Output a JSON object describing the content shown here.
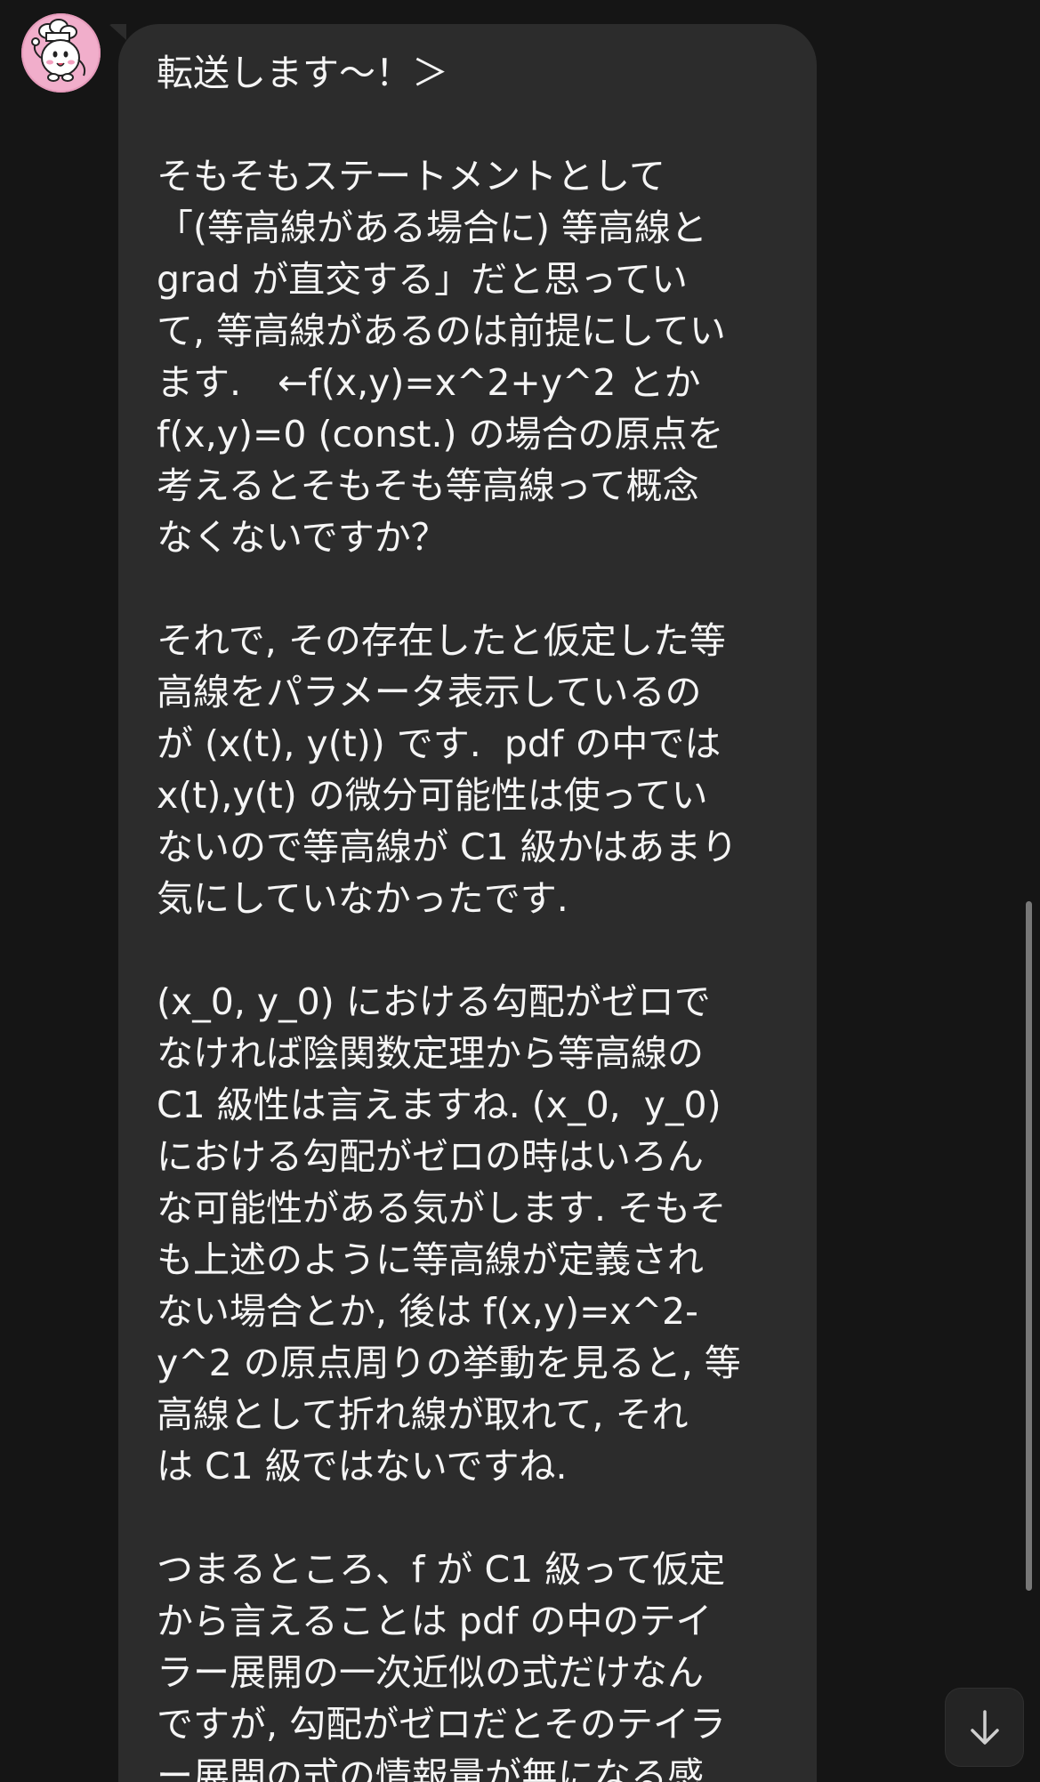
{
  "chat": {
    "message": {
      "lines": [
        "転送します〜！＞",
        "",
        "そもそもステートメントとして",
        "「(等高線がある場合に) 等高線と",
        "grad が直交する」だと思ってい",
        "て, 等高線があるのは前提にしてい",
        "ます.　←f(x,y)=x^2+y^2 とか",
        "f(x,y)=0 (const.) の場合の原点を",
        "考えるとそもそも等高線って概念",
        "なくないですか？",
        "",
        "それで, その存在したと仮定した等",
        "高線をパラメータ表示しているの",
        "が (x(t), y(t)) です.  pdf の中では",
        "x(t),y(t) の微分可能性は使ってい",
        "ないので等高線が C1 級かはあまり",
        "気にしていなかったです.",
        "",
        "(x_0, y_0) における勾配がゼロで",
        "なければ陰関数定理から等高線の",
        "C1 級性は言えますね. (x_0,  y_0)",
        "における勾配がゼロの時はいろん",
        "な可能性がある気がします. そもそ",
        "も上述のように等高線が定義され",
        "ない場合とか, 後は f(x,y)=x^2-",
        "y^2 の原点周りの挙動を見ると, 等",
        "高線として折れ線が取れて, それ",
        "は C1 級ではないですね.",
        "",
        "つまるところ、f が C1 級って仮定",
        "から言えることは pdf の中のテイ",
        "ラー展開の一次近似の式だけなん",
        "ですが, 勾配がゼロだとそのテイラ",
        "ー展開の式の情報量が無になる感"
      ],
      "bubble_color": "#2c2c2c",
      "text_color": "#f5f5f5"
    },
    "avatar": {
      "icon": "chef-character-avatar",
      "background": "#f1aecb"
    },
    "scroll_down_button": {
      "icon": "arrow-down-icon"
    },
    "background_color": "#151515"
  }
}
